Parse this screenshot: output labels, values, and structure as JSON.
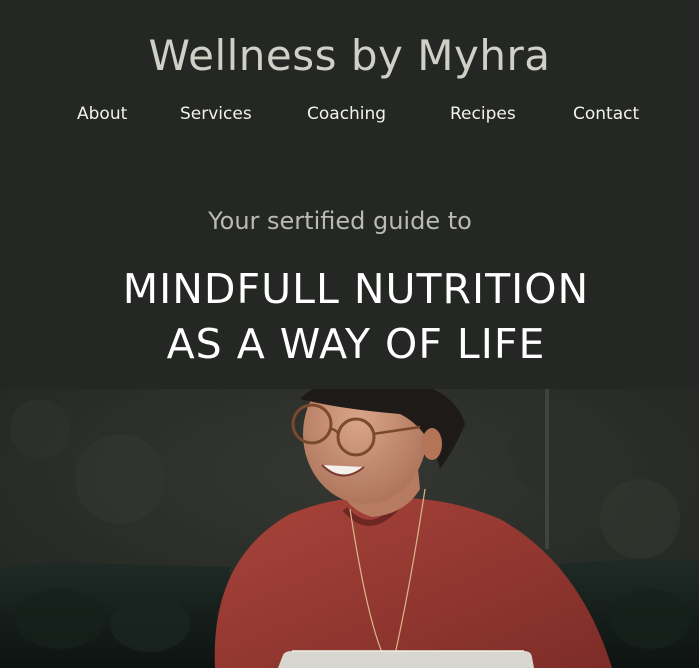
{
  "site": {
    "title": "Wellness by Myhra"
  },
  "nav": {
    "items": [
      {
        "label": "About"
      },
      {
        "label": "Services"
      },
      {
        "label": "Coaching"
      },
      {
        "label": "Recipes"
      },
      {
        "label": "Contact"
      }
    ]
  },
  "hero": {
    "tagline": "Your sertified guide to",
    "headline_line1": "MINDFULL NUTRITION",
    "headline_line2": "AS A WAY OF LIFE"
  },
  "colors": {
    "background": "#242723",
    "title": "#cfd0c8",
    "nav_text": "#f2f2ee",
    "tagline": "#b9bab3",
    "headline": "#ffffff",
    "sweater": "#9b3a33"
  }
}
